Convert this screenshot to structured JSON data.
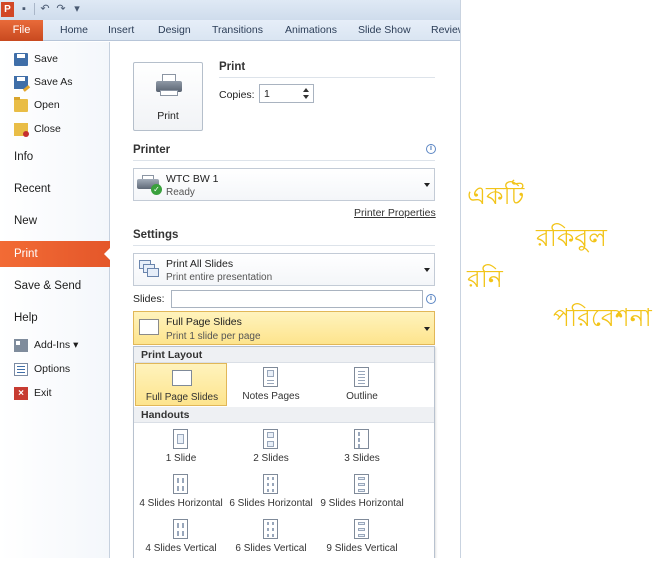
{
  "app": {
    "logo_letter": "P"
  },
  "ribbon": {
    "file_tab": "File",
    "tabs": [
      "Home",
      "Insert",
      "Design",
      "Transitions",
      "Animations",
      "Slide Show",
      "Review"
    ]
  },
  "nav": {
    "commands_top": [
      {
        "label": "Save",
        "icon": "save-icon"
      },
      {
        "label": "Save As",
        "icon": "save-as-icon"
      },
      {
        "label": "Open",
        "icon": "open-folder-icon"
      },
      {
        "label": "Close",
        "icon": "close-folder-icon"
      }
    ],
    "tabs": [
      "Info",
      "Recent",
      "New",
      "Print",
      "Save & Send",
      "Help"
    ],
    "active_tab": "Print",
    "commands_bottom": [
      {
        "label": "Add-Ins ▾",
        "icon": "add-ins-icon"
      },
      {
        "label": "Options",
        "icon": "options-icon"
      },
      {
        "label": "Exit",
        "icon": "exit-icon"
      }
    ]
  },
  "print": {
    "heading": "Print",
    "button_label": "Print",
    "copies_label": "Copies:",
    "copies_value": "1"
  },
  "printer": {
    "heading": "Printer",
    "name": "WTC BW 1",
    "status": "Ready",
    "properties_link": "Printer Properties"
  },
  "settings": {
    "heading": "Settings",
    "range_title": "Print All Slides",
    "range_subtitle": "Print entire presentation",
    "slides_label": "Slides:",
    "slides_value": "",
    "layout_title": "Full Page Slides",
    "layout_subtitle": "Print 1 slide per page"
  },
  "gallery": {
    "print_layout_heading": "Print Layout",
    "print_layout": [
      "Full Page Slides",
      "Notes Pages",
      "Outline"
    ],
    "selected": "Full Page Slides",
    "handouts_heading": "Handouts",
    "handouts": [
      "1 Slide",
      "2 Slides",
      "3 Slides",
      "4 Slides Horizontal",
      "6 Slides Horizontal",
      "9 Slides Horizontal",
      "4 Slides Vertical",
      "6 Slides Vertical",
      "9 Slides Vertical"
    ]
  },
  "overlay_text": {
    "line1": "একটি",
    "line2": "রকিবুল",
    "line3": "রনি",
    "line4": "পরিবেশনা",
    "color": "#f2c419"
  },
  "colors": {
    "accent_orange": "#e4572a",
    "highlight_yellow": "#fde48d"
  }
}
